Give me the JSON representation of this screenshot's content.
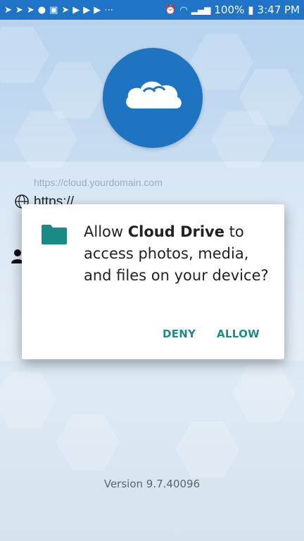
{
  "status_bar": {
    "left_icons": [
      "send-icon",
      "send-icon",
      "send-icon",
      "pinterest-icon",
      "linkedin-icon",
      "send-icon",
      "youtube-icon",
      "youtube-icon",
      "youtube-icon",
      "more-dots-icon"
    ],
    "battery": "100%",
    "time": "3:47 PM"
  },
  "login": {
    "url_placeholder": "https://cloud.yourdomain.com",
    "url_value": "https://"
  },
  "dialog": {
    "message_prefix": "Allow ",
    "app_name": "Cloud Drive",
    "message_suffix": " to access photos, media, and files on your device?",
    "deny_label": "DENY",
    "allow_label": "ALLOW"
  },
  "footer": {
    "version": "Version 9.7.40096"
  },
  "colors": {
    "status_bar": "#1f74c8",
    "logo_circle": "#1e74c1",
    "accent": "#1d8c87"
  }
}
